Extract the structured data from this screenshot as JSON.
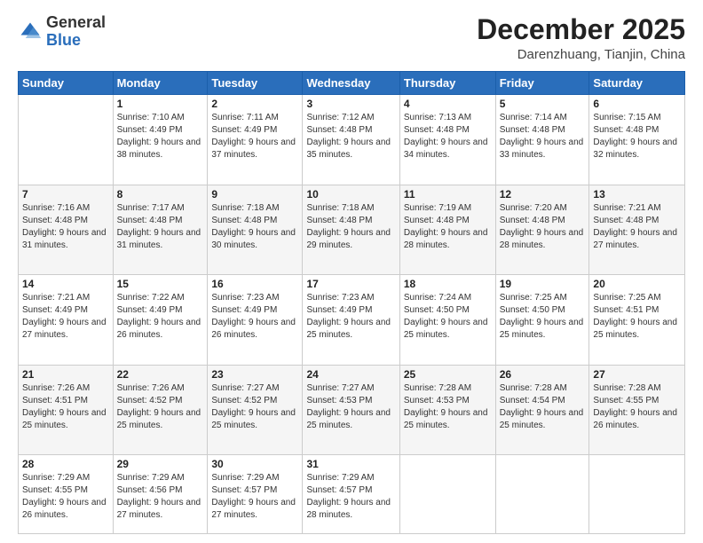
{
  "header": {
    "logo_general": "General",
    "logo_blue": "Blue",
    "month_title": "December 2025",
    "location": "Darenzhuang, Tianjin, China"
  },
  "weekdays": [
    "Sunday",
    "Monday",
    "Tuesday",
    "Wednesday",
    "Thursday",
    "Friday",
    "Saturday"
  ],
  "weeks": [
    [
      {
        "day": "",
        "sunrise": "",
        "sunset": "",
        "daylight": ""
      },
      {
        "day": "1",
        "sunrise": "Sunrise: 7:10 AM",
        "sunset": "Sunset: 4:49 PM",
        "daylight": "Daylight: 9 hours and 38 minutes."
      },
      {
        "day": "2",
        "sunrise": "Sunrise: 7:11 AM",
        "sunset": "Sunset: 4:49 PM",
        "daylight": "Daylight: 9 hours and 37 minutes."
      },
      {
        "day": "3",
        "sunrise": "Sunrise: 7:12 AM",
        "sunset": "Sunset: 4:48 PM",
        "daylight": "Daylight: 9 hours and 35 minutes."
      },
      {
        "day": "4",
        "sunrise": "Sunrise: 7:13 AM",
        "sunset": "Sunset: 4:48 PM",
        "daylight": "Daylight: 9 hours and 34 minutes."
      },
      {
        "day": "5",
        "sunrise": "Sunrise: 7:14 AM",
        "sunset": "Sunset: 4:48 PM",
        "daylight": "Daylight: 9 hours and 33 minutes."
      },
      {
        "day": "6",
        "sunrise": "Sunrise: 7:15 AM",
        "sunset": "Sunset: 4:48 PM",
        "daylight": "Daylight: 9 hours and 32 minutes."
      }
    ],
    [
      {
        "day": "7",
        "sunrise": "Sunrise: 7:16 AM",
        "sunset": "Sunset: 4:48 PM",
        "daylight": "Daylight: 9 hours and 31 minutes."
      },
      {
        "day": "8",
        "sunrise": "Sunrise: 7:17 AM",
        "sunset": "Sunset: 4:48 PM",
        "daylight": "Daylight: 9 hours and 31 minutes."
      },
      {
        "day": "9",
        "sunrise": "Sunrise: 7:18 AM",
        "sunset": "Sunset: 4:48 PM",
        "daylight": "Daylight: 9 hours and 30 minutes."
      },
      {
        "day": "10",
        "sunrise": "Sunrise: 7:18 AM",
        "sunset": "Sunset: 4:48 PM",
        "daylight": "Daylight: 9 hours and 29 minutes."
      },
      {
        "day": "11",
        "sunrise": "Sunrise: 7:19 AM",
        "sunset": "Sunset: 4:48 PM",
        "daylight": "Daylight: 9 hours and 28 minutes."
      },
      {
        "day": "12",
        "sunrise": "Sunrise: 7:20 AM",
        "sunset": "Sunset: 4:48 PM",
        "daylight": "Daylight: 9 hours and 28 minutes."
      },
      {
        "day": "13",
        "sunrise": "Sunrise: 7:21 AM",
        "sunset": "Sunset: 4:48 PM",
        "daylight": "Daylight: 9 hours and 27 minutes."
      }
    ],
    [
      {
        "day": "14",
        "sunrise": "Sunrise: 7:21 AM",
        "sunset": "Sunset: 4:49 PM",
        "daylight": "Daylight: 9 hours and 27 minutes."
      },
      {
        "day": "15",
        "sunrise": "Sunrise: 7:22 AM",
        "sunset": "Sunset: 4:49 PM",
        "daylight": "Daylight: 9 hours and 26 minutes."
      },
      {
        "day": "16",
        "sunrise": "Sunrise: 7:23 AM",
        "sunset": "Sunset: 4:49 PM",
        "daylight": "Daylight: 9 hours and 26 minutes."
      },
      {
        "day": "17",
        "sunrise": "Sunrise: 7:23 AM",
        "sunset": "Sunset: 4:49 PM",
        "daylight": "Daylight: 9 hours and 25 minutes."
      },
      {
        "day": "18",
        "sunrise": "Sunrise: 7:24 AM",
        "sunset": "Sunset: 4:50 PM",
        "daylight": "Daylight: 9 hours and 25 minutes."
      },
      {
        "day": "19",
        "sunrise": "Sunrise: 7:25 AM",
        "sunset": "Sunset: 4:50 PM",
        "daylight": "Daylight: 9 hours and 25 minutes."
      },
      {
        "day": "20",
        "sunrise": "Sunrise: 7:25 AM",
        "sunset": "Sunset: 4:51 PM",
        "daylight": "Daylight: 9 hours and 25 minutes."
      }
    ],
    [
      {
        "day": "21",
        "sunrise": "Sunrise: 7:26 AM",
        "sunset": "Sunset: 4:51 PM",
        "daylight": "Daylight: 9 hours and 25 minutes."
      },
      {
        "day": "22",
        "sunrise": "Sunrise: 7:26 AM",
        "sunset": "Sunset: 4:52 PM",
        "daylight": "Daylight: 9 hours and 25 minutes."
      },
      {
        "day": "23",
        "sunrise": "Sunrise: 7:27 AM",
        "sunset": "Sunset: 4:52 PM",
        "daylight": "Daylight: 9 hours and 25 minutes."
      },
      {
        "day": "24",
        "sunrise": "Sunrise: 7:27 AM",
        "sunset": "Sunset: 4:53 PM",
        "daylight": "Daylight: 9 hours and 25 minutes."
      },
      {
        "day": "25",
        "sunrise": "Sunrise: 7:28 AM",
        "sunset": "Sunset: 4:53 PM",
        "daylight": "Daylight: 9 hours and 25 minutes."
      },
      {
        "day": "26",
        "sunrise": "Sunrise: 7:28 AM",
        "sunset": "Sunset: 4:54 PM",
        "daylight": "Daylight: 9 hours and 25 minutes."
      },
      {
        "day": "27",
        "sunrise": "Sunrise: 7:28 AM",
        "sunset": "Sunset: 4:55 PM",
        "daylight": "Daylight: 9 hours and 26 minutes."
      }
    ],
    [
      {
        "day": "28",
        "sunrise": "Sunrise: 7:29 AM",
        "sunset": "Sunset: 4:55 PM",
        "daylight": "Daylight: 9 hours and 26 minutes."
      },
      {
        "day": "29",
        "sunrise": "Sunrise: 7:29 AM",
        "sunset": "Sunset: 4:56 PM",
        "daylight": "Daylight: 9 hours and 27 minutes."
      },
      {
        "day": "30",
        "sunrise": "Sunrise: 7:29 AM",
        "sunset": "Sunset: 4:57 PM",
        "daylight": "Daylight: 9 hours and 27 minutes."
      },
      {
        "day": "31",
        "sunrise": "Sunrise: 7:29 AM",
        "sunset": "Sunset: 4:57 PM",
        "daylight": "Daylight: 9 hours and 28 minutes."
      },
      {
        "day": "",
        "sunrise": "",
        "sunset": "",
        "daylight": ""
      },
      {
        "day": "",
        "sunrise": "",
        "sunset": "",
        "daylight": ""
      },
      {
        "day": "",
        "sunrise": "",
        "sunset": "",
        "daylight": ""
      }
    ]
  ]
}
